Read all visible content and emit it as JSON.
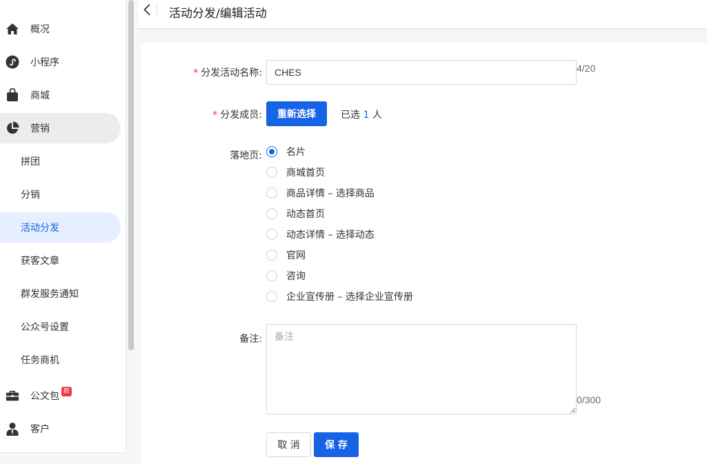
{
  "sidebar": {
    "items": [
      {
        "label": "概况",
        "icon": "home-icon"
      },
      {
        "label": "小程序",
        "icon": "miniprogram-icon"
      },
      {
        "label": "商城",
        "icon": "shopping-bag-icon"
      },
      {
        "label": "营销",
        "icon": "pie-chart-icon"
      },
      {
        "label": "拼团"
      },
      {
        "label": "分销"
      },
      {
        "label": "活动分发"
      },
      {
        "label": "获客文章"
      },
      {
        "label": "群发服务通知"
      },
      {
        "label": "公众号设置"
      },
      {
        "label": "任务商机"
      },
      {
        "label": "公文包",
        "icon": "briefcase-icon",
        "badge": "新"
      },
      {
        "label": "客户",
        "icon": "user-icon"
      }
    ]
  },
  "header": {
    "title": "活动分发/编辑活动"
  },
  "form": {
    "name": {
      "label": "分发活动名称:",
      "value": "CHES",
      "counter": "4/20"
    },
    "members": {
      "label": "分发成员:",
      "button": "重新选择",
      "selected_prefix": "已选",
      "selected_count": "1",
      "selected_suffix": "人"
    },
    "landing": {
      "label": "落地页:",
      "options": [
        {
          "label": "名片",
          "checked": true
        },
        {
          "label": "商城首页",
          "checked": false
        },
        {
          "label": "商品详情 – 选择商品",
          "checked": false
        },
        {
          "label": "动态首页",
          "checked": false
        },
        {
          "label": "动态详情 – 选择动态",
          "checked": false
        },
        {
          "label": "官网",
          "checked": false
        },
        {
          "label": "咨询",
          "checked": false
        },
        {
          "label": "企业宣传册 – 选择企业宣传册",
          "checked": false
        }
      ]
    },
    "remark": {
      "label": "备注:",
      "placeholder": "备注",
      "counter": "0/300"
    },
    "cancel_label": "取 消",
    "save_label": "保 存"
  },
  "colors": {
    "primary": "#1763e6",
    "required": "#e5342a",
    "badge": "#f0344a"
  }
}
